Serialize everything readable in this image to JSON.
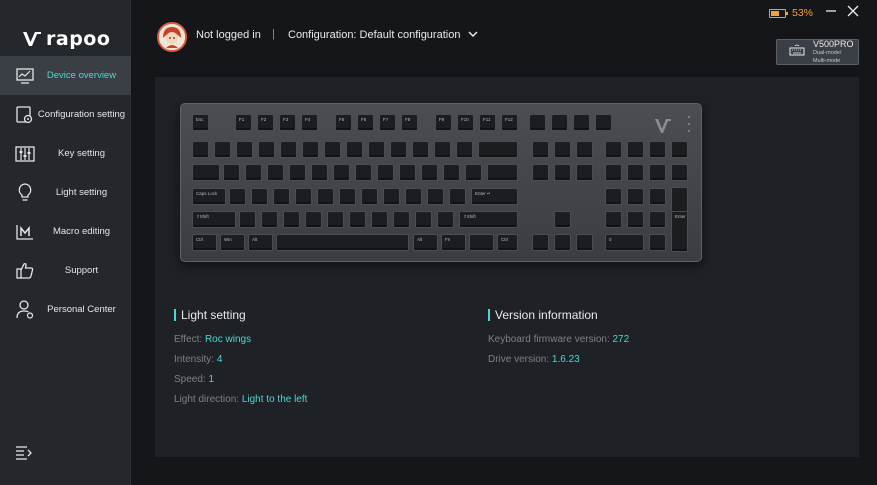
{
  "brand": {
    "name": "rapoo",
    "accent": "#4fd6d1"
  },
  "sidebar": {
    "items": [
      {
        "id": "device-overview",
        "label": "Device overview",
        "icon": "monitor-chart-icon",
        "active": true
      },
      {
        "id": "configuration-setting",
        "label": "Configuration setting",
        "icon": "gear-document-icon",
        "active": false
      },
      {
        "id": "key-setting",
        "label": "Key setting",
        "icon": "sliders-icon",
        "active": false
      },
      {
        "id": "light-setting",
        "label": "Light setting",
        "icon": "lightbulb-icon",
        "active": false
      },
      {
        "id": "macro-editing",
        "label": "Macro editing",
        "icon": "macro-m-icon",
        "active": false
      },
      {
        "id": "support",
        "label": "Support",
        "icon": "thumbs-up-icon",
        "active": false
      },
      {
        "id": "personal-center",
        "label": "Personal Center",
        "icon": "user-gear-icon",
        "active": false
      }
    ],
    "collapse_icon": "collapse-menu-icon"
  },
  "header": {
    "login_status": "Not logged in",
    "separator": "|",
    "configuration": "Configuration: Default configuration",
    "battery_percent": "53%",
    "battery_level": 0.53,
    "battery_color": "#f0a23b",
    "device": {
      "model": "V500PRO",
      "mode_line1": "Dual-mode/",
      "mode_line2": "Multi-mode"
    }
  },
  "keyboard_keys": {
    "esc": "Esc",
    "f": [
      "F1",
      "F2",
      "F3",
      "F4",
      "F5",
      "F6",
      "F7",
      "F8",
      "F9",
      "F10",
      "F11",
      "F12"
    ],
    "caps": "Caps Lock",
    "enter": "Enter ↵",
    "lshift": "⇧Shift",
    "rshift": "⇧Shift",
    "ctrl": "Ctrl",
    "win": "Win",
    "alt": "Alt",
    "fn": "Fn",
    "numenter": "Enter",
    "num0": "0"
  },
  "light": {
    "title": "Light setting",
    "effect_label": "Effect: ",
    "effect_value": "Roc wings",
    "intensity_label": "Intensity: ",
    "intensity_value": "4",
    "speed_label": "Speed: ",
    "speed_value": "1",
    "direction_label": "Light direction: ",
    "direction_value": "Light to the left"
  },
  "version": {
    "title": "Version information",
    "firmware_label": "Keyboard firmware version: ",
    "firmware_value": "272",
    "drive_label": "Drive version: ",
    "drive_value": "1.6.23"
  }
}
